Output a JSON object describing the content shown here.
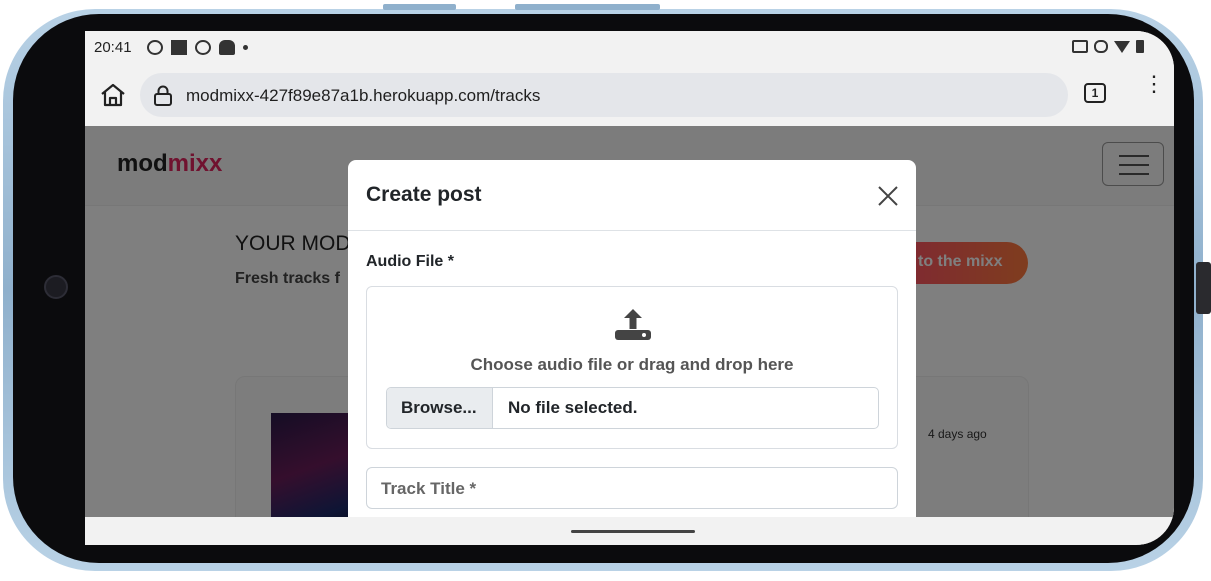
{
  "status_bar": {
    "time": "20:41"
  },
  "browser": {
    "url": "modmixx-427f89e87a1b.herokuapp.com/tracks",
    "tab_count": "1"
  },
  "site": {
    "brand_part1": "mod",
    "brand_part2": "mixx",
    "hero_title": "YOUR MOD",
    "hero_subtitle": "Fresh tracks f",
    "cta_label": "to the mixx",
    "card_time": "4 days ago",
    "brand_color": "#e0245e"
  },
  "modal": {
    "title": "Create post",
    "audio_label": "Audio File *",
    "drop_text": "Choose audio file or drag and drop here",
    "browse_label": "Browse...",
    "file_status": "No file selected.",
    "track_title_placeholder": "Track Title *"
  },
  "icons": [
    "home-icon",
    "lock-icon",
    "tabs-icon",
    "more-icon",
    "menu-icon",
    "close-icon",
    "upload-icon"
  ]
}
